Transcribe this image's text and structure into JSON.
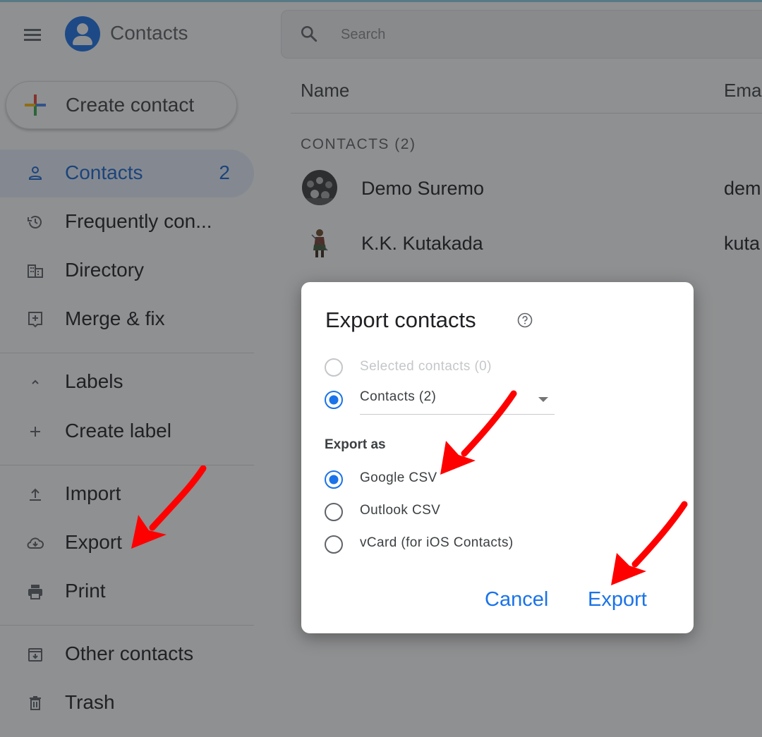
{
  "header": {
    "app_title": "Contacts",
    "search_placeholder": "Search"
  },
  "create_button": {
    "label": "Create contact"
  },
  "sidebar": {
    "items": [
      {
        "label": "Contacts",
        "count": "2",
        "active": true,
        "icon": "person-icon"
      },
      {
        "label": "Frequently con...",
        "icon": "history-icon"
      },
      {
        "label": "Directory",
        "icon": "building-icon"
      },
      {
        "label": "Merge & fix",
        "icon": "merge-icon"
      }
    ],
    "labels_section": {
      "label": "Labels",
      "icon": "chevron-up-icon"
    },
    "create_label": {
      "label": "Create label",
      "icon": "plus-icon"
    },
    "tools": [
      {
        "label": "Import",
        "icon": "upload-icon"
      },
      {
        "label": "Export",
        "icon": "cloud-download-icon"
      },
      {
        "label": "Print",
        "icon": "printer-icon"
      }
    ],
    "bottom": [
      {
        "label": "Other contacts",
        "icon": "archive-icon"
      },
      {
        "label": "Trash",
        "icon": "trash-icon"
      }
    ]
  },
  "table": {
    "columns": [
      "Name",
      "Ema"
    ],
    "section_label": "CONTACTS (2)",
    "rows": [
      {
        "name": "Demo Suremo",
        "email": "dem"
      },
      {
        "name": "K.K. Kutakada",
        "email": "kuta"
      }
    ]
  },
  "dialog": {
    "title": "Export contacts",
    "scope_options": [
      {
        "label": "Selected contacts (0)",
        "selected": false,
        "disabled": true
      },
      {
        "label": "Contacts (2)",
        "selected": true,
        "disabled": false
      }
    ],
    "export_as_label": "Export as",
    "format_options": [
      {
        "label": "Google CSV",
        "selected": true
      },
      {
        "label": "Outlook CSV",
        "selected": false
      },
      {
        "label": "vCard (for iOS Contacts)",
        "selected": false
      }
    ],
    "cancel_label": "Cancel",
    "export_label": "Export"
  },
  "colors": {
    "accent": "#1a73e8",
    "scrim": "rgba(32,33,36,0.5)",
    "annotation": "#ff0000"
  }
}
